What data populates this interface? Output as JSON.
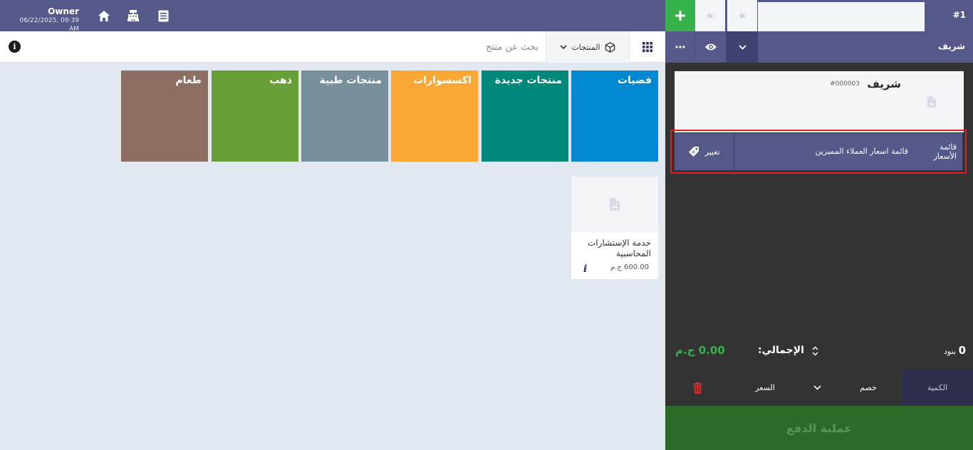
{
  "header": {
    "user_name": "Owner",
    "datetime": "06/22/2025, 09:39 AM",
    "icons": [
      "home-icon",
      "cash-register-icon",
      "list-icon"
    ]
  },
  "search": {
    "placeholder": "بحث عن منتج",
    "products_dropdown_label": "المنتجات"
  },
  "categories": [
    {
      "label": "فضيات",
      "color": "#0288d1"
    },
    {
      "label": "منتجات جديدة",
      "color": "#00897b"
    },
    {
      "label": "اكسسوارات",
      "color": "#f9a835"
    },
    {
      "label": "منتجات طبية",
      "color": "#78909c"
    },
    {
      "label": "ذهب",
      "color": "#689f38"
    },
    {
      "label": "طعام",
      "color": "#8d6e63"
    }
  ],
  "products": [
    {
      "name": "خدمة الإستشارات المحاسبية",
      "price": "600.00 ج.م"
    }
  ],
  "order": {
    "number": "#1",
    "customer_short": "شريف",
    "customer_name": "شريف",
    "customer_id": "#000003"
  },
  "price_list": {
    "label": "قائمة الأسعار",
    "value": "قائمة اسعار العملاء المميزين",
    "change_label": "تغيير"
  },
  "summary": {
    "items_count": "0",
    "items_label": "بنود",
    "total_label": "الإجمالي:",
    "total_value": "0.00 ج.م"
  },
  "tabs": {
    "quantity": "الكمية",
    "discount": "خصم",
    "price": "السعر"
  },
  "payment_button": "عملية الدفع",
  "colors": {
    "header_bg": "#55598a",
    "accent_green": "#37b24d",
    "highlight_red": "#e11d1d"
  }
}
